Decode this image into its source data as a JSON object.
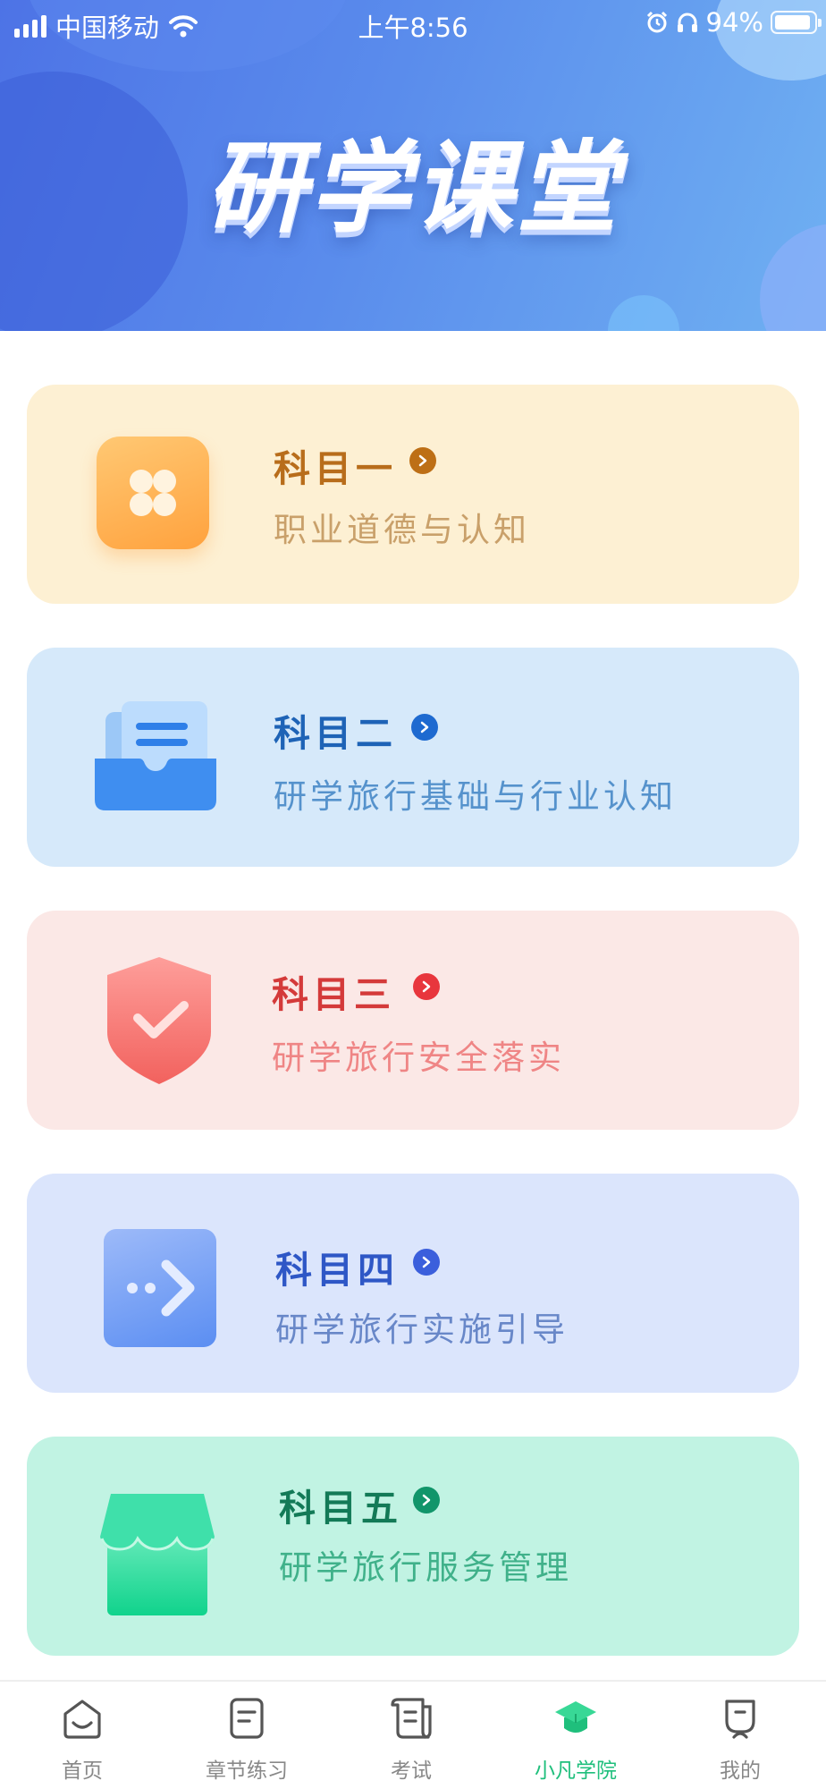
{
  "status_bar": {
    "carrier": "中国移动",
    "time": "上午8:56",
    "battery": "94%"
  },
  "header": {
    "title": "研学课堂"
  },
  "subjects": [
    {
      "title": "科目一",
      "subtitle": "职业道德与认知",
      "icon": "four-petal-icon",
      "colors": {
        "bg": "#fdf0d3",
        "title": "#b86d1b",
        "subtitle": "#c9a06a",
        "arrow": "#bd6f16"
      }
    },
    {
      "title": "科目二",
      "subtitle": "研学旅行基础与行业认知",
      "icon": "document-tray-icon",
      "colors": {
        "bg": "#d6e9fa",
        "title": "#1e63b6",
        "subtitle": "#5592cc",
        "arrow": "#1e6ad0"
      }
    },
    {
      "title": "科目三",
      "subtitle": "研学旅行安全落实",
      "icon": "shield-check-icon",
      "colors": {
        "bg": "#fbe8e6",
        "title": "#d43a3a",
        "subtitle": "#ef8585",
        "arrow": "#e8363d"
      }
    },
    {
      "title": "科目四",
      "subtitle": "研学旅行实施引导",
      "icon": "forward-arrow-icon",
      "colors": {
        "bg": "#dbe5fc",
        "title": "#2e57c6",
        "subtitle": "#6887c8",
        "arrow": "#3b5fdc"
      }
    },
    {
      "title": "科目五",
      "subtitle": "研学旅行服务管理",
      "icon": "store-icon",
      "colors": {
        "bg": "#c1f3e3",
        "title": "#137a57",
        "subtitle": "#40b18a",
        "arrow": "#11956a"
      }
    }
  ],
  "tabbar": {
    "items": [
      {
        "label": "首页",
        "icon": "home-icon",
        "active": false
      },
      {
        "label": "章节练习",
        "icon": "notes-icon",
        "active": false
      },
      {
        "label": "考试",
        "icon": "exam-scroll-icon",
        "active": false
      },
      {
        "label": "小凡学院",
        "icon": "graduation-cap-icon",
        "active": true
      },
      {
        "label": "我的",
        "icon": "profile-icon",
        "active": false
      }
    ],
    "active_color": "#1fbf7c",
    "inactive_color": "#888888"
  }
}
